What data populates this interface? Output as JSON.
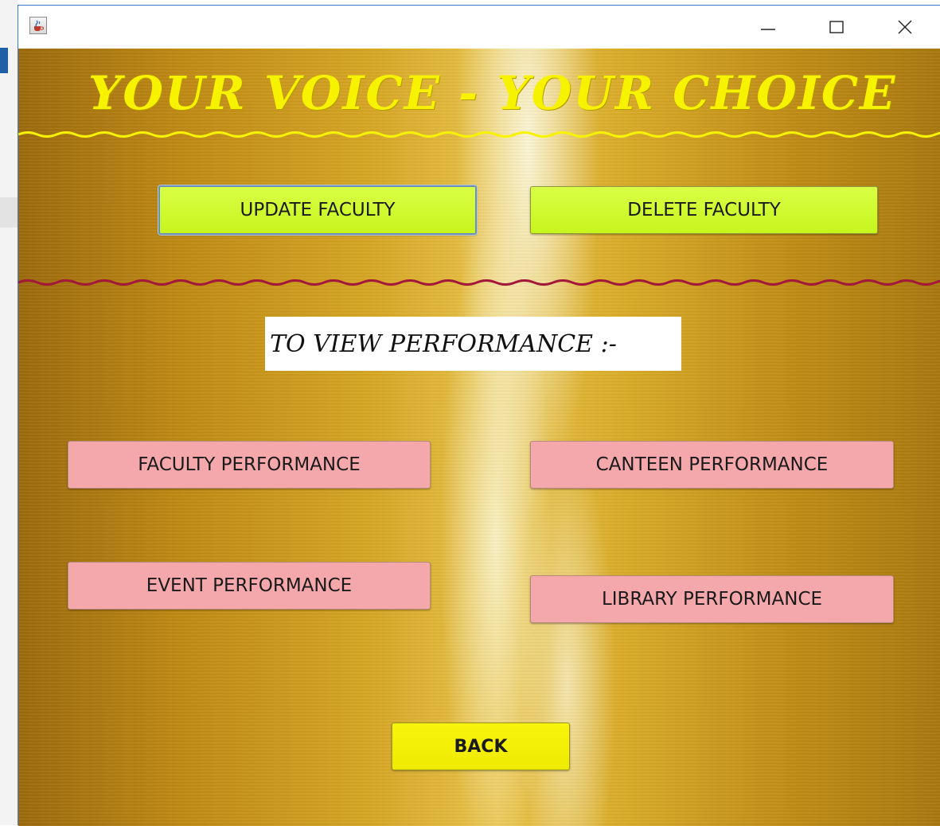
{
  "window": {
    "app_icon": "java-cup-icon",
    "controls": {
      "minimize_icon": "minimize-icon",
      "maximize_icon": "maximize-icon",
      "close_icon": "close-icon"
    }
  },
  "header": {
    "title": "YOUR VOICE - YOUR CHOICE"
  },
  "faculty_actions": {
    "update_label": "UPDATE FACULTY",
    "delete_label": "DELETE FACULTY"
  },
  "performance": {
    "heading": "TO VIEW PERFORMANCE :-",
    "faculty_label": "FACULTY PERFORMANCE",
    "canteen_label": "CANTEEN PERFORMANCE",
    "event_label": "EVENT PERFORMANCE",
    "library_label": "LIBRARY PERFORMANCE"
  },
  "footer": {
    "back_label": "BACK"
  },
  "colors": {
    "title_yellow": "#f7f300",
    "wave_yellow": "#f7f300",
    "wave_red": "#a3173a",
    "button_green": "#c7f51d",
    "button_pink": "#f5a8ac",
    "button_yellow": "#f2ee00",
    "background_gold": "#d6a624"
  }
}
